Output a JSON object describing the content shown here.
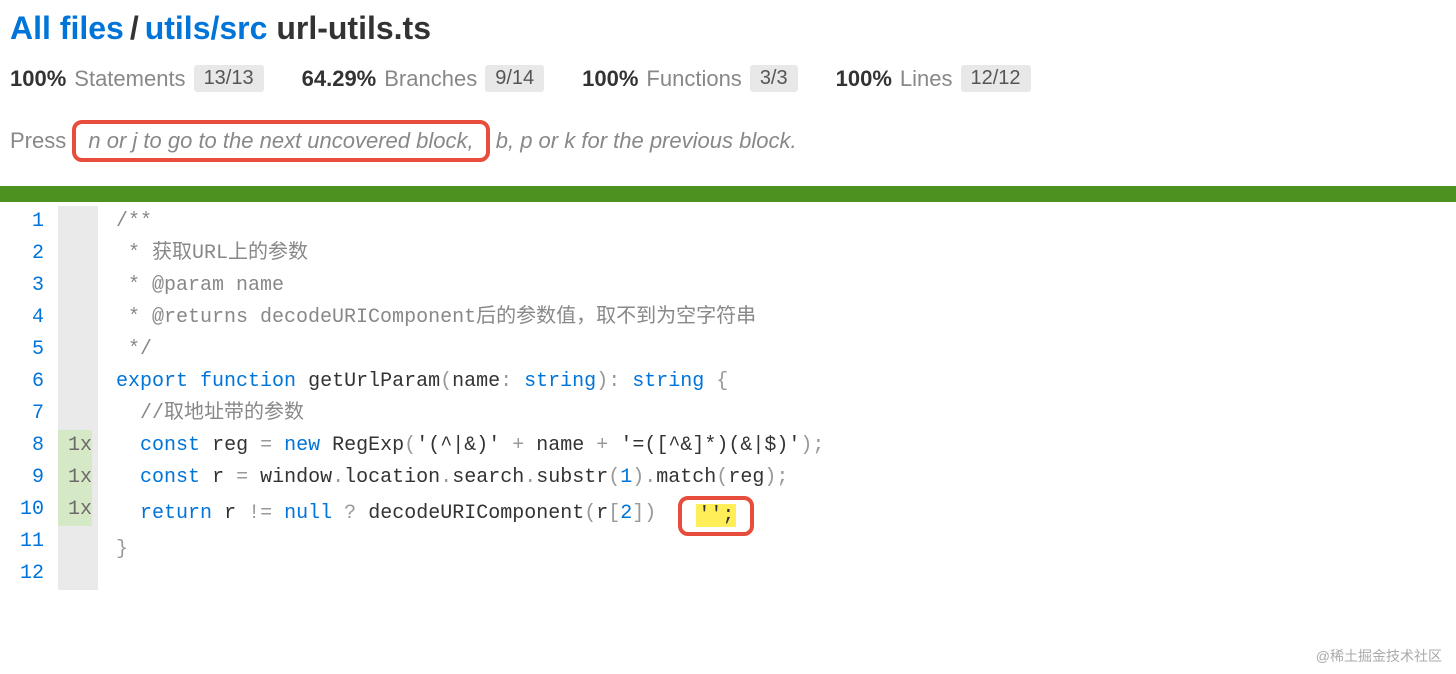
{
  "breadcrumb": {
    "root": "All files",
    "path": "utils/src",
    "file": "url-utils.ts"
  },
  "stats": {
    "statements": {
      "pct": "100%",
      "label": "Statements",
      "frac": "13/13"
    },
    "branches": {
      "pct": "64.29%",
      "label": "Branches",
      "frac": "9/14"
    },
    "functions": {
      "pct": "100%",
      "label": "Functions",
      "frac": "3/3"
    },
    "lines": {
      "pct": "100%",
      "label": "Lines",
      "frac": "12/12"
    }
  },
  "help": {
    "prefix": "Press",
    "highlighted": "n or j to go to the next uncovered block,",
    "suffix": " b, p or k for the previous block."
  },
  "code": {
    "lineCount": 12,
    "execCounts": [
      "",
      "",
      "",
      "",
      "",
      "",
      "",
      "1x",
      "1x",
      "1x",
      "",
      ""
    ],
    "lines": {
      "l1": "/**",
      "l2": " * 获取URL上的参数",
      "l3": " * @param name",
      "l4": " * @returns decodeURIComponent后的参数值，取不到为空字符串",
      "l5": " */",
      "l7": "  //取地址带的参数",
      "uncov": "'';"
    },
    "tokens": {
      "export": "export",
      "function": "function",
      "fnName": "getUrlParam",
      "paramName": "name",
      "colon1": ":",
      "stringType": "string",
      "retType": "string",
      "openBrace": "{",
      "const": "const",
      "reg": "reg",
      "eq": "=",
      "new": "new",
      "RegExp": "RegExp",
      "regexStr1": "'(^|&)'",
      "plus": "+",
      "nameVar": "name",
      "regexStr2": "'=([^&]*)(&|$)'",
      "r": "r",
      "window": "window",
      "location": "location",
      "search": "search",
      "substr": "substr",
      "one": "1",
      "match": "match",
      "return": "return",
      "neq": "!=",
      "null": "null",
      "qmark": "?",
      "decode": "decodeURIComponent",
      "two": "2",
      "closeBrace": "}"
    }
  },
  "watermark": "@稀土掘金技术社区"
}
